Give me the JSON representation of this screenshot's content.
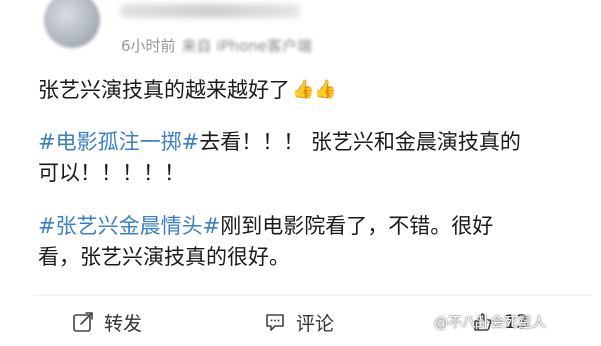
{
  "post": {
    "time": "6小时前",
    "source": "来自 iPhone客户端",
    "line1_text": "张艺兴演技真的越来越好了",
    "line1_emoji": "👍👍",
    "p2_tag": "#电影孤注一掷#",
    "p2_text_a": "去看！！！ 张艺兴和金晨演技真的",
    "p2_text_b": "可以！！！！！",
    "p3_tag": "#张艺兴金晨情头#",
    "p3_text_a": "刚到电影院看了，不错。很好",
    "p3_text_b": "看，张艺兴演技真的很好。"
  },
  "actions": {
    "repost_label": "转发",
    "comment_label": "评论",
    "like_count": "13"
  },
  "watermark": {
    "text": "@不八卦会死星人"
  },
  "colors": {
    "tag": "#3b7fc4",
    "meta": "#999999",
    "text": "#1a1a1a"
  }
}
